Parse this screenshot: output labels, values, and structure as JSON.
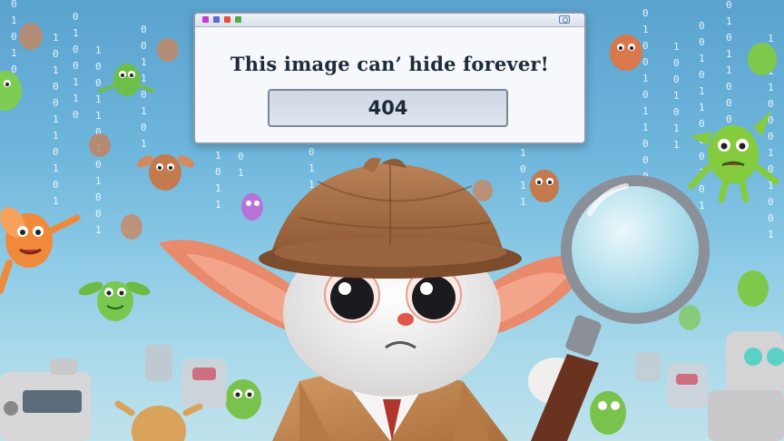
{
  "dialog": {
    "message": "This image can’ hide forever!",
    "code": "404",
    "titlebar_icons": [
      "app-icon",
      "ok-icon",
      "warning-icon",
      "check-icon"
    ],
    "window_control_icon": "maximize-icon"
  },
  "scene": {
    "subject": "detective-gremlin",
    "props": [
      "deerstalker-hat",
      "magnifying-glass",
      "trench-coat"
    ],
    "background_elements": [
      "falling-binary-digits",
      "floating-gremlins",
      "robots"
    ],
    "binary_digits": [
      "0",
      "1",
      "0",
      "1",
      "0",
      "0",
      "1",
      "1",
      "0",
      "1",
      "0",
      "1",
      "0",
      "0",
      "1",
      "0",
      "1",
      "1",
      "0",
      "0"
    ],
    "colors": {
      "sky": "#6fb6dc",
      "hat": "#a9724a",
      "fur": "#f1efee",
      "ears": "#e98a6d",
      "coat": "#c58b57",
      "handle": "#6a3320",
      "lens_rim": "#8a8f98"
    }
  }
}
